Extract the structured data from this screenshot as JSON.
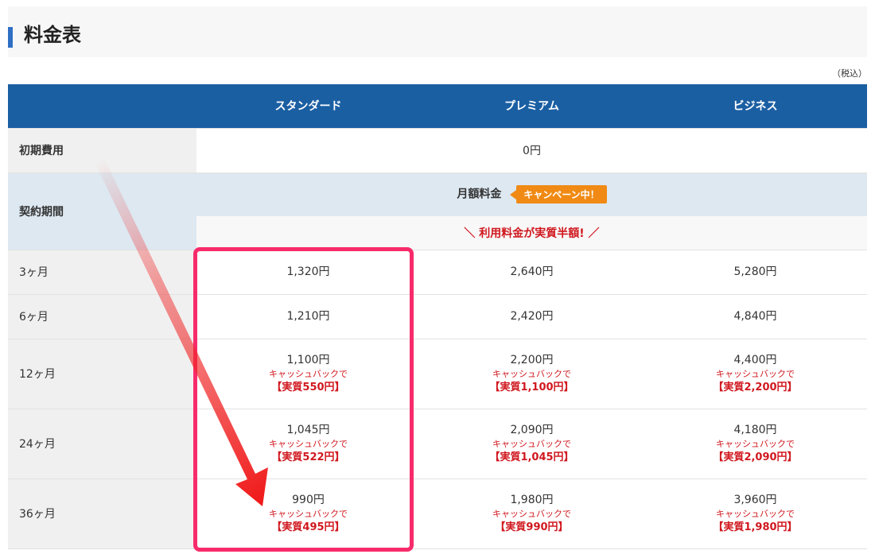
{
  "title": "料金表",
  "tax_note": "（税込）",
  "plans": [
    "スタンダード",
    "プレミアム",
    "ビジネス"
  ],
  "initial_fee": {
    "label": "初期費用",
    "value": "0円"
  },
  "contract": {
    "label": "契約期間",
    "monthly_label": "月額料金",
    "campaign_badge": "キャンペーン中！",
    "half_price": "＼ 利用料金が実質半額! ／"
  },
  "rows": [
    {
      "label": "3ヶ月",
      "prices": [
        "1,320円",
        "2,640円",
        "5,280円"
      ]
    },
    {
      "label": "6ヶ月",
      "prices": [
        "1,210円",
        "2,420円",
        "4,840円"
      ]
    },
    {
      "label": "12ヶ月",
      "prices": [
        "1,100円",
        "2,200円",
        "4,400円"
      ],
      "cashback": "キャッシュバックで",
      "real": [
        "【実質550円】",
        "【実質1,100円】",
        "【実質2,200円】"
      ]
    },
    {
      "label": "24ヶ月",
      "prices": [
        "1,045円",
        "2,090円",
        "4,180円"
      ],
      "cashback": "キャッシュバックで",
      "real": [
        "【実質522円】",
        "【実質1,045円】",
        "【実質2,090円】"
      ]
    },
    {
      "label": "36ヶ月",
      "prices": [
        "990円",
        "1,980円",
        "3,960円"
      ],
      "cashback": "キャッシュバックで",
      "real": [
        "【実質495円】",
        "【実質990円】",
        "【実質1,980円】"
      ]
    }
  ],
  "colors": {
    "header_bg": "#1b5fa3",
    "accent": "#2f6fc4",
    "campaign": "#f08a14",
    "discount_red": "#d0181f",
    "highlight": "#f72b6b"
  }
}
